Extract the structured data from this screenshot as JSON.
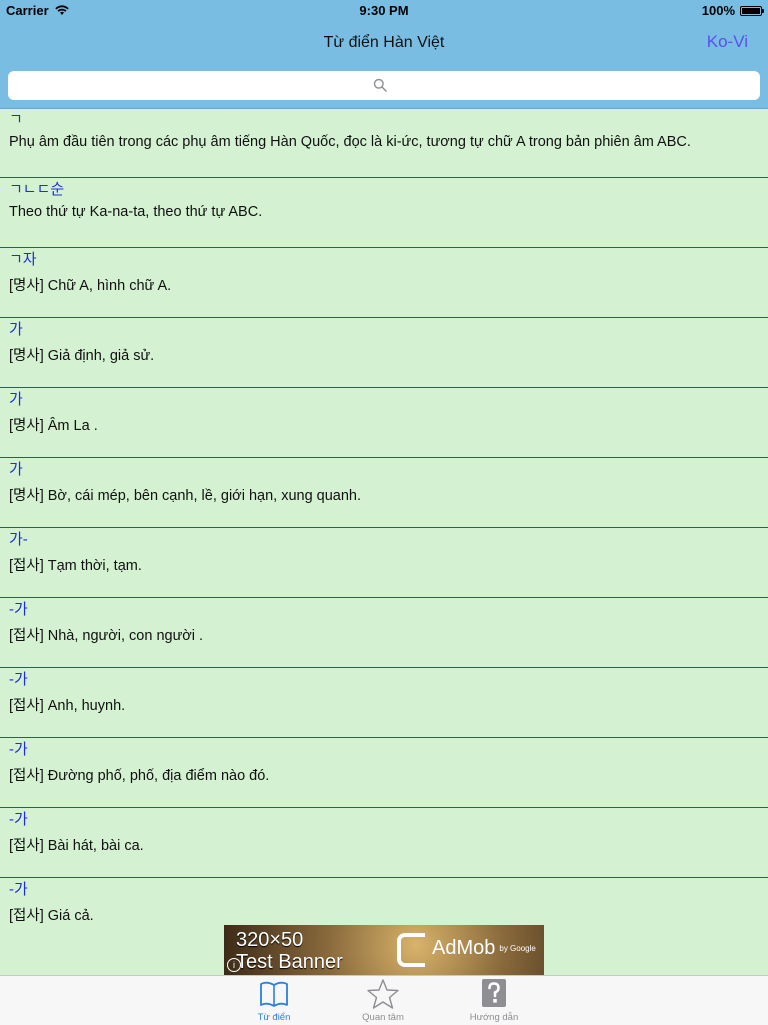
{
  "status_bar": {
    "carrier": "Carrier",
    "time": "9:30 PM",
    "battery": "100%"
  },
  "nav": {
    "title": "Từ điển Hàn Việt",
    "right_button": "Ko-Vi"
  },
  "search": {
    "placeholder": ""
  },
  "entries": [
    {
      "term": "ㄱ",
      "definition": "Phụ âm đầu tiên trong các phụ âm tiếng Hàn Quốc, đọc là ki-ức, tương tự chữ A trong bản phiên âm ABC."
    },
    {
      "term": "ㄱㄴㄷ순",
      "definition": "Theo thứ tự Ka-na-ta, theo thứ tự ABC."
    },
    {
      "term": "ㄱ자",
      "definition": "[명사] Chữ A, hình chữ A."
    },
    {
      "term": "가",
      "definition": "[명사] Giả định, giả sử."
    },
    {
      "term": "가",
      "definition": "[명사] Âm La ."
    },
    {
      "term": "가",
      "definition": "[명사] Bờ, cái mép, bên cạnh, lề, giới hạn, xung quanh."
    },
    {
      "term": "가-",
      "definition": "[접사] Tạm thời, tạm."
    },
    {
      "term": "-가",
      "definition": "[접사] Nhà, người, con người ."
    },
    {
      "term": "-가",
      "definition": "[접사] Anh, huynh."
    },
    {
      "term": "-가",
      "definition": "[접사] Đường phố, phố, địa điểm nào đó."
    },
    {
      "term": "-가",
      "definition": "[접사] Bài hát, bài ca."
    },
    {
      "term": "-가",
      "definition": "[접사] Giá cả."
    }
  ],
  "ad": {
    "line1": "320×50",
    "line2": "Test Banner",
    "brand": "AdMob",
    "brand_sub": "by Google",
    "info": "i"
  },
  "tabs": [
    {
      "label": "Từ điển",
      "icon": "book-icon",
      "active": true
    },
    {
      "label": "Quan tâm",
      "icon": "star-icon",
      "active": false
    },
    {
      "label": "Hướng dẫn",
      "icon": "help-icon",
      "active": false
    }
  ],
  "colors": {
    "header": "#7abde3",
    "list_background": "#d4f2d2",
    "term_text": "#1f2ed6",
    "divider": "#2b44e6",
    "nav_button": "#5b4ff0",
    "tab_active": "#2a7fe0"
  }
}
